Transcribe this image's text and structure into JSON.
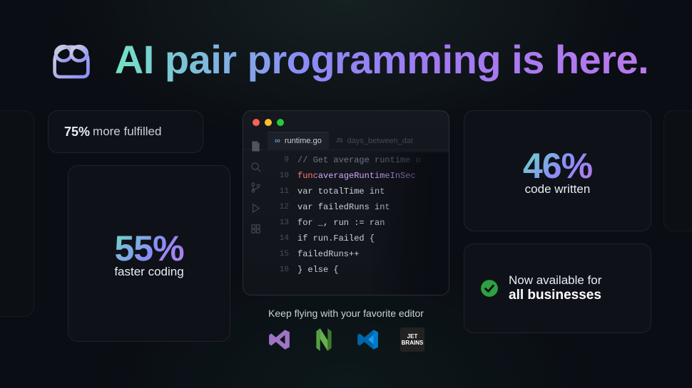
{
  "hero": {
    "title": "AI pair programming is here."
  },
  "cards": {
    "fulfilled": {
      "pct": "75%",
      "label": "more fulfilled"
    },
    "faster": {
      "pct": "55%",
      "label": "faster coding"
    },
    "written": {
      "pct": "46%",
      "label": "code written"
    },
    "avail": {
      "line1": "Now available for",
      "line2": "all businesses"
    }
  },
  "editor": {
    "tabs": {
      "active_icon": "∞",
      "active": "runtime.go",
      "inactive_icon": "JS",
      "inactive": "days_between_dat"
    },
    "code": [
      {
        "n": "9",
        "cls": "cm",
        "t": "// Get average runtime o"
      },
      {
        "n": "10",
        "cls": "",
        "t": ""
      },
      {
        "n": "11",
        "cls": "vn",
        "t": "    var totalTime int"
      },
      {
        "n": "12",
        "cls": "vn",
        "t": "    var failedRuns int"
      },
      {
        "n": "13",
        "cls": "vn",
        "t": "    for _, run := ran"
      },
      {
        "n": "14",
        "cls": "vn",
        "t": "        if run.Failed {"
      },
      {
        "n": "15",
        "cls": "vn",
        "t": "            failedRuns++"
      },
      {
        "n": "16",
        "cls": "vn",
        "t": "        } else {"
      }
    ],
    "line10": {
      "kw": "func",
      "fn": "averageRuntimeInSec"
    }
  },
  "editors_caption": "Keep flying with your favorite editor",
  "editors": {
    "jb1": "JET",
    "jb2": "BRAINS"
  }
}
